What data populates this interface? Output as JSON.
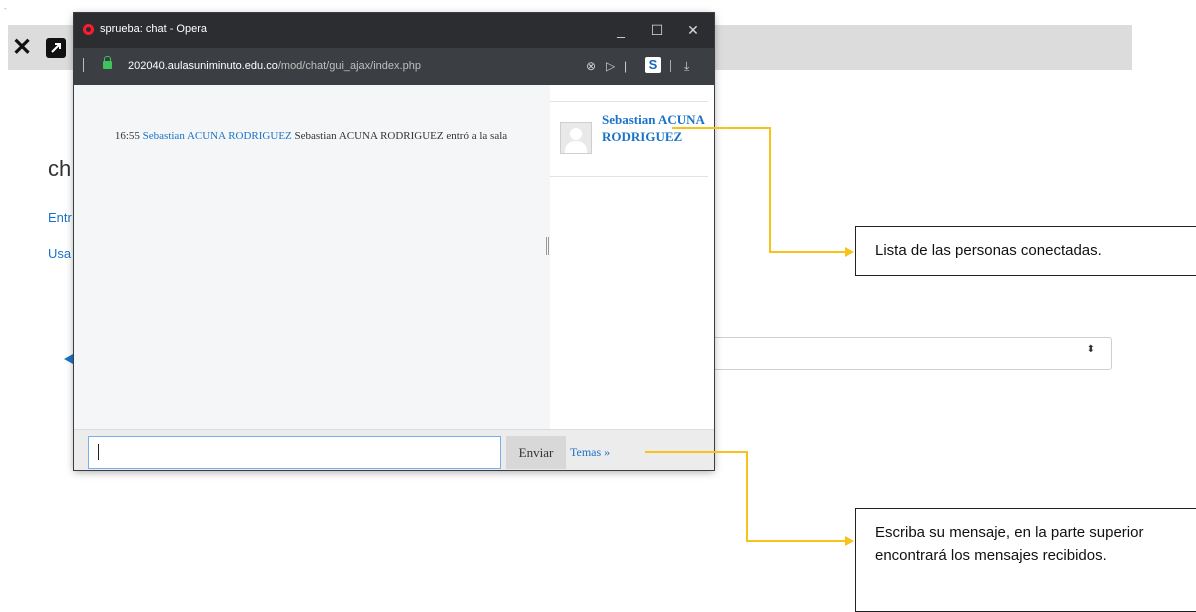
{
  "background": {
    "heading": "ch",
    "link1": "Entr",
    "link2": "Usa"
  },
  "window": {
    "title": "sprueba: chat - Opera",
    "url_host": "202040.aulasuniminuto.edu.co",
    "url_path": "/mod/chat/gui_ajax/index.php"
  },
  "chat": {
    "messages": [
      {
        "time": "16:55",
        "user": "Sebastian ACUNA RODRIGUEZ",
        "text": "Sebastian ACUNA RODRIGUEZ entró a la sala"
      }
    ],
    "users": [
      {
        "name": "Sebastian ACUNA RODRIGUEZ"
      }
    ],
    "input_value": "",
    "send_label": "Enviar",
    "temas_label": "Temas »"
  },
  "annotations": {
    "users_callout": "Lista de las personas conectadas.",
    "input_callout": "Escriba su mensaje, en la parte superior encontrará los mensajes recibidos."
  },
  "colors": {
    "accent_link": "#1a73c9",
    "annotation_line": "#f7c21b",
    "titlebar": "#2b2d31"
  }
}
